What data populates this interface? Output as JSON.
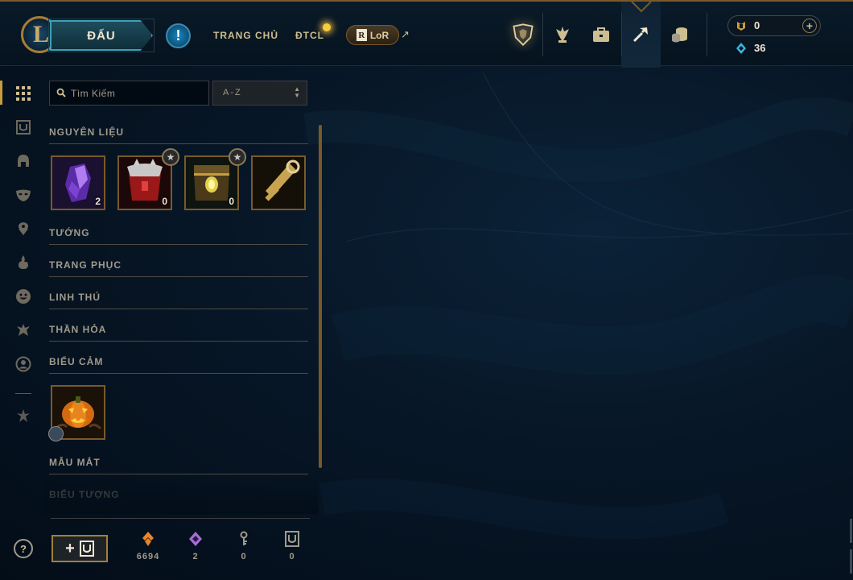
{
  "header": {
    "play_label": "ĐẤU",
    "alert_glyph": "!",
    "nav": [
      {
        "label": "TRANG CHỦ"
      },
      {
        "label": "ĐTCL"
      }
    ],
    "lor_button": {
      "badge": "R",
      "label": "LoR",
      "link_glyph": "↗"
    },
    "icons": [
      "honors-crest-icon",
      "ranked-icon",
      "collection-bag-icon",
      "loot-crafting-icon",
      "store-coins-icon"
    ],
    "currency": {
      "rp_value": "0",
      "blue_essence_value": "36",
      "plus_glyph": "+"
    }
  },
  "sidebar": {
    "icons": [
      "grid-icon",
      "chest-icon",
      "champion-helmet-icon",
      "skin-mask-icon",
      "ward-icon",
      "ward-skin-icon",
      "emote-face-icon",
      "summoner-icon-icon",
      "profile-icon",
      "eternals-icon"
    ]
  },
  "filters": {
    "search_placeholder": "Tìm Kiếm",
    "sort_value": "A-Z",
    "sort_arrows": "▲▼"
  },
  "sections": {
    "materials": "NGUYÊN LIỆU",
    "champions": "TƯỚNG",
    "skins": "TRANG PHỤC",
    "pets": "LINH THÚ",
    "ward_skins": "THẦN HỎA",
    "emotes": "BIỂU CẢM",
    "chromas": "MẪU MẮT",
    "icons": "BIỂU TƯỢNG"
  },
  "materials": [
    {
      "name": "crystal-shard",
      "count": "2"
    },
    {
      "name": "masterwork-chest",
      "count": "0",
      "starred": true
    },
    {
      "name": "hextech-chest",
      "count": "0",
      "starred": true
    },
    {
      "name": "hextech-key",
      "count": ""
    }
  ],
  "emotes": [
    {
      "name": "pumpkin-emote"
    }
  ],
  "footer": {
    "help_glyph": "?",
    "add_chest_glyph": "+",
    "stats": [
      {
        "name": "orange-essence",
        "value": "6694",
        "color": "#e8842c"
      },
      {
        "name": "mythic-essence",
        "value": "2",
        "color": "#a66cd8"
      },
      {
        "name": "key-fragment",
        "value": "0",
        "color": "#a09b8c"
      },
      {
        "name": "chests",
        "value": "0",
        "color": "#a09b8c"
      }
    ]
  },
  "colors": {
    "gold": "#c89b3c",
    "gold_dark": "#785a28",
    "text": "#a09b8c",
    "bg": "#010a13"
  }
}
